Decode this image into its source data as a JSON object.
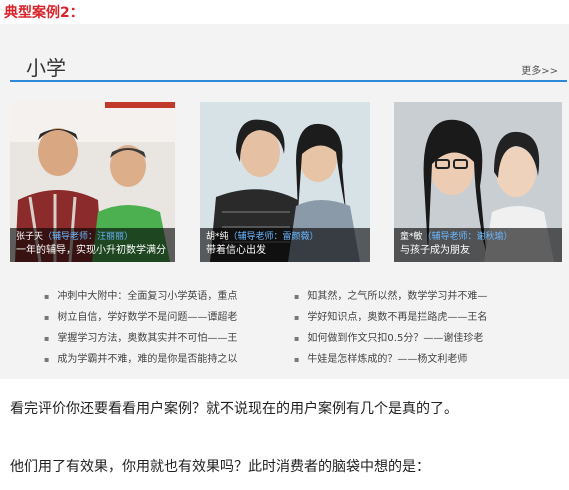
{
  "case_title": "典型案例2：",
  "section": {
    "title": "小学",
    "more": "更多>>"
  },
  "cards": [
    {
      "name": "张子天",
      "teacher": "（辅导老师：汪丽丽）",
      "tagline": "一年的辅导，实现小升初数学满分"
    },
    {
      "name": "胡*纯",
      "teacher": "（辅导老师：雷颜薇）",
      "tagline": "带着信心出发"
    },
    {
      "name": "童*敏",
      "teacher": "（辅导老师：谢秋瑜）",
      "tagline": "与孩子成为朋友"
    }
  ],
  "links_left": [
    "冲刺中大附中：全面复习小学英语，重点",
    "树立自信，学好数学不是问题——谭超老",
    "掌握学习方法，奥数其实并不可怕——王",
    "成为学霸并不难，难的是你是否能持之以"
  ],
  "links_right": [
    "知其然，之气所以然，数学学习并不难—",
    "学好知识点，奥数不再是拦路虎——王名",
    "如何做到作文只扣0.5分？——谢佳珍老",
    "牛娃是怎样炼成的？——杨文利老师"
  ],
  "paragraphs": [
    "看完评价你还要看看用户案例？就不说现在的用户案例有几个是真的了。",
    "他们用了有效果，你用就也有效果吗？此时消费者的脑袋中想的是："
  ]
}
